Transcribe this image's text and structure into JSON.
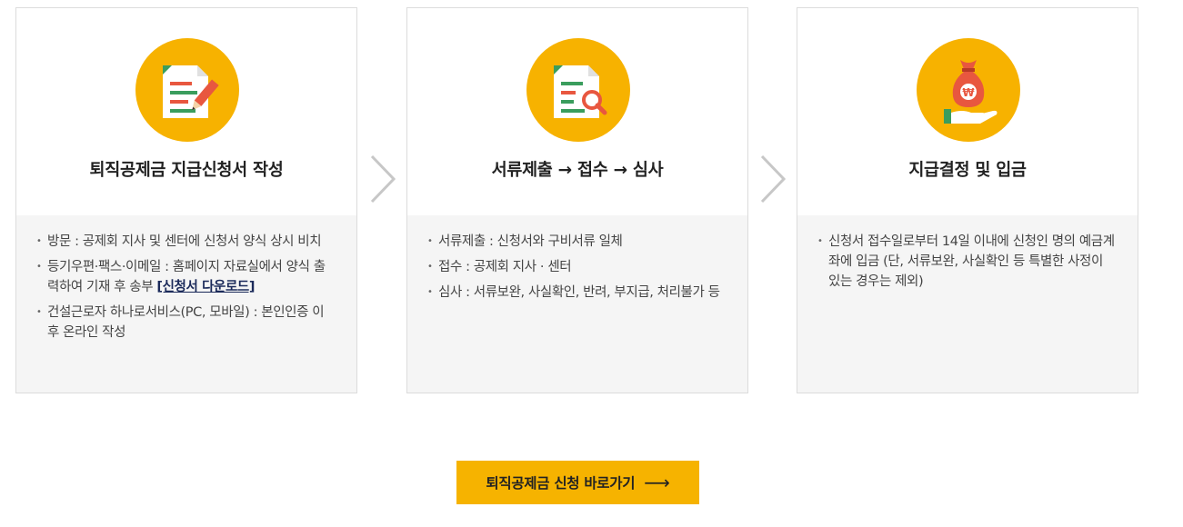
{
  "steps": [
    {
      "title": "퇴직공제금 지급신청서 작성",
      "icon": "document-pen-icon",
      "items": [
        "방문 : 공제회 지사 및 센터에 신청서 양식 상시 비치",
        "등기우편·팩스·이메일 : 홈페이지 자료실에서 양식 출력하여 기재 후 송부",
        "건설근로자 하나로서비스(PC, 모바일) : 본인인증 이후 온라인 작성"
      ],
      "link_label": "[신청서 다운로드]"
    },
    {
      "title": "서류제출 → 접수 → 심사",
      "icon": "document-search-icon",
      "items": [
        "서류제출 : 신청서와 구비서류 일체",
        "접수 : 공제회 지사 · 센터",
        "심사 : 서류보완, 사실확인, 반려, 부지급, 처리불가 등"
      ]
    },
    {
      "title": "지급결정 및 입금",
      "icon": "money-bag-hand-icon",
      "items": [
        "신청서 접수일로부터 14일 이내에 신청인 명의 예금계좌에 입금 (단, 서류보완, 사실확인 등 특별한 사정이 있는 경우는 제외)"
      ]
    }
  ],
  "cta": {
    "label": "퇴직공제금 신청 바로가기",
    "arrow": "⟶"
  },
  "colors": {
    "accent": "#f6b300",
    "card_bg": "#f5f5f5",
    "link": "#1b2a5a",
    "border": "#dcdcdc"
  }
}
